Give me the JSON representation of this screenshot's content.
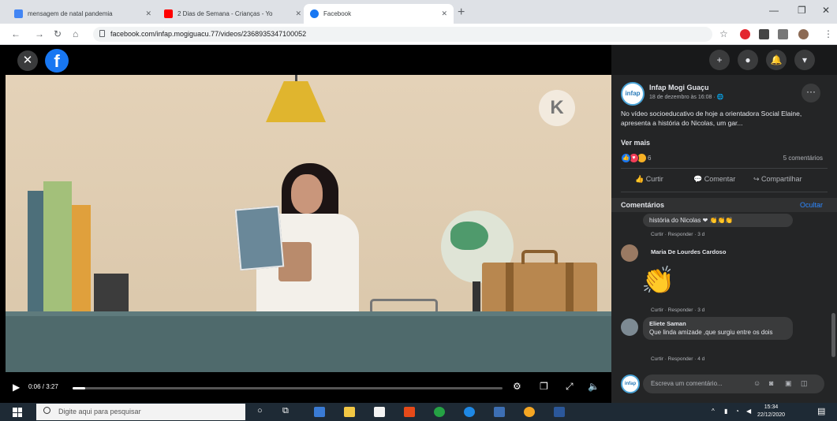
{
  "browser": {
    "tabs": [
      {
        "label": "mensagem de natal pandemia",
        "icon": "google-icon",
        "color": "#4285f4"
      },
      {
        "label": "2 Dias de Semana - Crianças - Yo",
        "icon": "youtube-icon",
        "color": "#ff0000"
      },
      {
        "label": "Facebook",
        "icon": "facebook-icon",
        "color": "#1877f2"
      }
    ],
    "new_tab": "+",
    "url": "facebook.com/infap.mogiguacu.77/videos/2368935347100052"
  },
  "video": {
    "close": "✕",
    "logo": "f",
    "watermark": "K",
    "current_time": "0:06",
    "duration": "3:27",
    "time_display": "0:06 / 3:27",
    "progress": 0.03
  },
  "panel": {
    "top_buttons": [
      "+",
      "●",
      "🔔",
      "▾"
    ],
    "page_name": "Infap Mogi Guaçu",
    "page_avatar": "infap",
    "post_date": "18 de dezembro às 16:08 · 🌐",
    "post_text": "No vídeo socioeducativo de hoje a orientadora Social Elaine, apresenta a história do Nicolas, um gar...",
    "see_more": "Ver mais",
    "reaction_count": "6",
    "comment_count": "5 comentários",
    "actions": {
      "like": "Curtir",
      "comment": "Comentar",
      "share": "Compartilhar"
    },
    "comments_header": "Comentários",
    "hide": "Ocultar",
    "comments": [
      {
        "text": "história do Nicolas ❤ 👏👏👏",
        "meta": "Curtir · Responder · 3 d"
      },
      {
        "author": "Maria De Lourdes Cardoso",
        "emoji": "👏",
        "meta": "Curtir · Responder · 3 d"
      },
      {
        "author": "Eliete Saman",
        "text": "Que linda amizade ,que surgiu entre os dois",
        "meta": "Curtir · Responder · 4 d"
      }
    ],
    "write_placeholder": "Escreva um comentário..."
  },
  "taskbar": {
    "search_placeholder": "Digite aqui para pesquisar",
    "time": "15:34",
    "date": "22/12/2020"
  },
  "colors": {
    "facebook_blue": "#1877f2",
    "panel_bg": "#242526",
    "lamp": "#e0b52e"
  }
}
